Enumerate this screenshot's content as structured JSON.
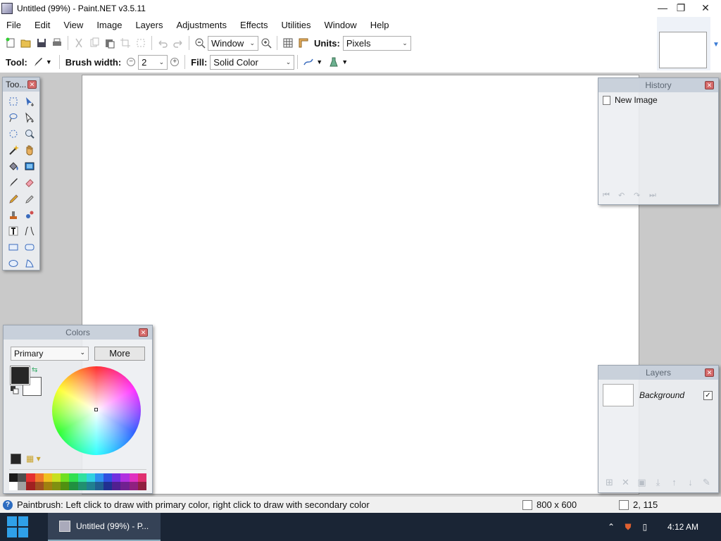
{
  "window": {
    "title": "Untitled (99%) - Paint.NET v3.5.11",
    "minimize": "—",
    "restore": "❐",
    "close": "✕"
  },
  "menu": [
    "File",
    "Edit",
    "View",
    "Image",
    "Layers",
    "Adjustments",
    "Effects",
    "Utilities",
    "Window",
    "Help"
  ],
  "toolbar1": {
    "zoom_value": "Window",
    "units_label": "Units:",
    "units_value": "Pixels"
  },
  "toolbar2": {
    "tool_label": "Tool:",
    "brush_width_label": "Brush width:",
    "brush_width_value": "2",
    "fill_label": "Fill:",
    "fill_value": "Solid Color"
  },
  "tools_panel": {
    "title": "Too...",
    "icons": [
      "rectangle-select-icon",
      "move-selection-icon",
      "lasso-select-icon",
      "move-selected-icon",
      "ellipse-select-icon",
      "zoom-icon",
      "magic-wand-icon",
      "pan-icon",
      "paint-bucket-icon",
      "gradient-icon",
      "paintbrush-icon",
      "eraser-icon",
      "pencil-icon",
      "color-picker-icon",
      "clone-stamp-icon",
      "recolor-icon",
      "text-icon",
      "line-curve-icon",
      "rectangle-icon",
      "rounded-rectangle-icon",
      "ellipse-icon",
      "freeform-shape-icon"
    ]
  },
  "history_panel": {
    "title": "History",
    "items": [
      "New Image"
    ]
  },
  "layers_panel": {
    "title": "Layers",
    "items": [
      {
        "name": "Background",
        "visible": true
      }
    ]
  },
  "colors_panel": {
    "title": "Colors",
    "mode": "Primary",
    "more_label": "More",
    "primary_color": "#262626",
    "secondary_color": "#ffffff",
    "palette_top": [
      "#1a1a1a",
      "#4d4d4d",
      "#e53030",
      "#f07a2a",
      "#f0c020",
      "#c8e020",
      "#70e020",
      "#30e050",
      "#30e0a0",
      "#30d0e0",
      "#3090f0",
      "#3050e0",
      "#7030e0",
      "#b030e0",
      "#e030c0",
      "#e03070"
    ],
    "palette_bottom": [
      "#ffffff",
      "#a0a0a0",
      "#a02020",
      "#a05020",
      "#a08010",
      "#809010",
      "#509010",
      "#209040",
      "#209070",
      "#208090",
      "#206090",
      "#203090",
      "#502090",
      "#702090",
      "#902080",
      "#902040"
    ]
  },
  "status": {
    "message": "Paintbrush: Left click to draw with primary color, right click to draw with secondary color",
    "image_size": "800 x 600",
    "cursor_pos": "2, 115"
  },
  "taskbar": {
    "app_label": "Untitled (99%) - P...",
    "time": "4:12 AM"
  }
}
